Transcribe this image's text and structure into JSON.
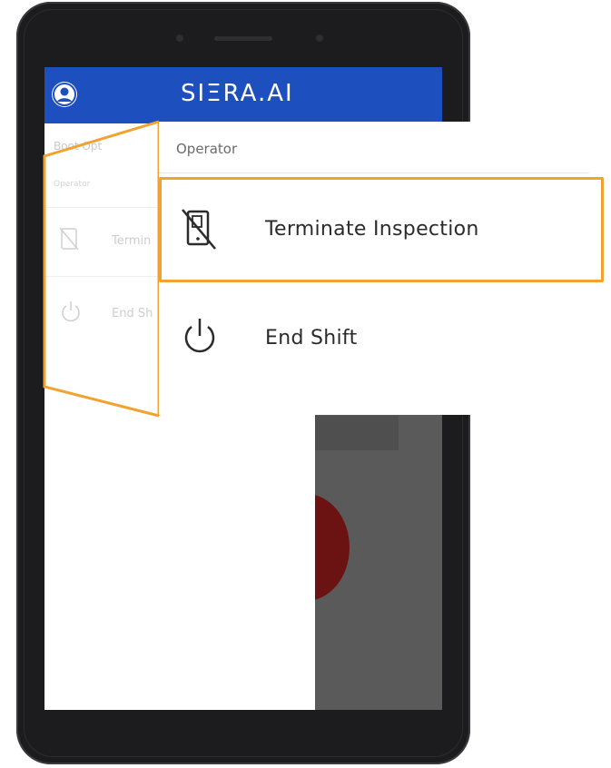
{
  "app": {
    "brand": "SIΞRA.AI"
  },
  "drawer": {
    "section_title": "Operator",
    "faded_section_title": "Boot Opt",
    "faded_sub_label": "Operator",
    "faded_items": [
      {
        "label": "Termin",
        "icon": "no-tablet-icon"
      },
      {
        "label": "End Sh",
        "icon": "power-icon"
      }
    ]
  },
  "callout": {
    "section_title": "Operator",
    "items": [
      {
        "label": "Terminate Inspection",
        "icon": "no-tablet-icon",
        "highlighted": true
      },
      {
        "label": "End Shift",
        "icon": "power-icon",
        "highlighted": false
      }
    ]
  },
  "colors": {
    "header_blue": "#1d4fbf",
    "highlight_orange": "#f0a331",
    "device_frame": "#1c1c1e"
  }
}
